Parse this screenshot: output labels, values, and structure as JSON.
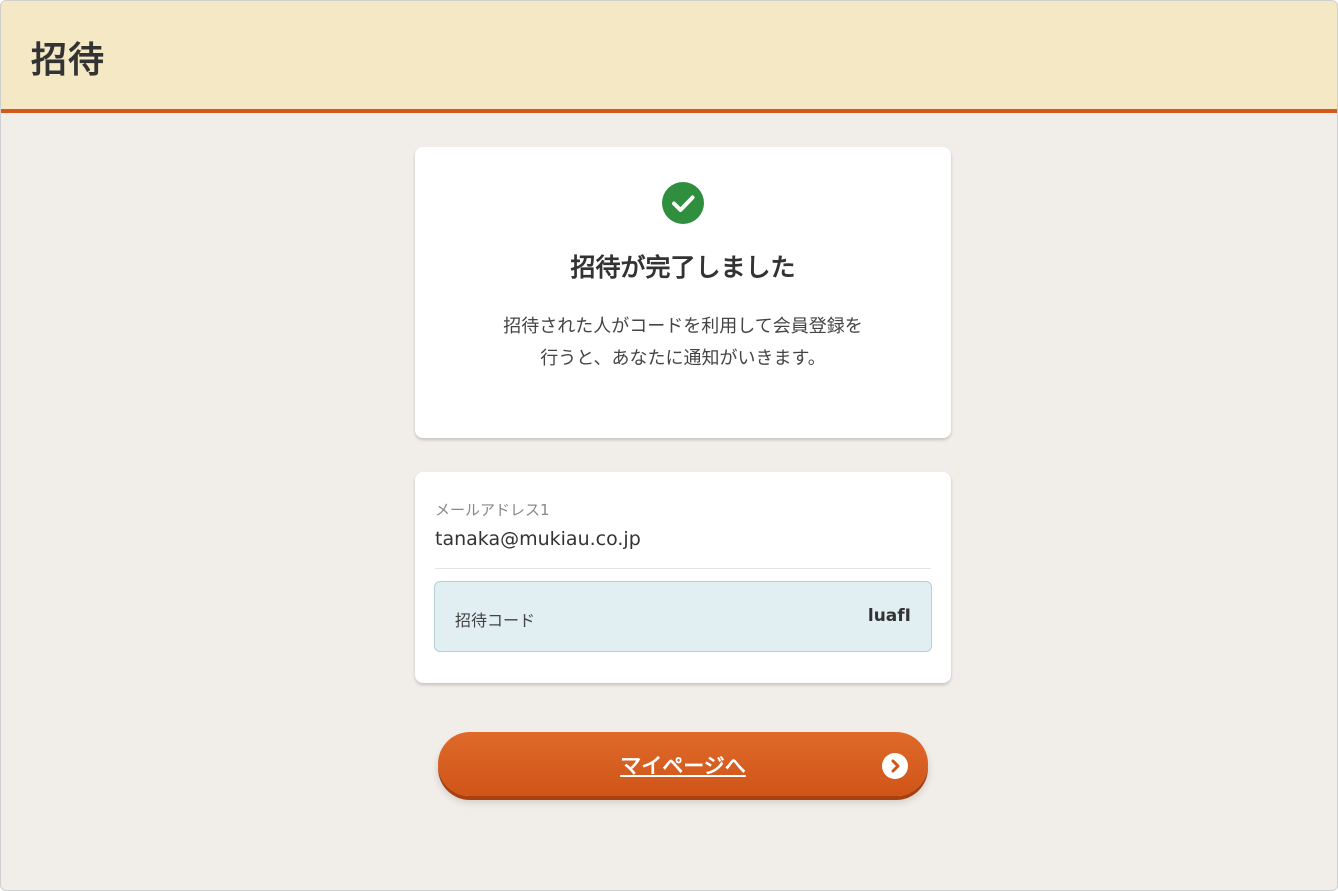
{
  "header": {
    "title": "招待"
  },
  "completion": {
    "icon": "check-circle-icon",
    "title": "招待が完了しました",
    "message": "招待された人がコードを利用して会員登録を行うと、あなたに通知がいきます。"
  },
  "invite": {
    "email_label": "メールアドレス1",
    "email_value": "tanaka@mukiau.co.jp",
    "code_label": "招待コード",
    "code_value": "luafI"
  },
  "actions": {
    "mypage_label": "マイページへ",
    "mypage_icon": "chevron-right-circle-icon"
  },
  "colors": {
    "accent": "#d35a1c",
    "success": "#2f8f3e",
    "header_bg": "#f5e8c4",
    "code_bg": "#e1eef2"
  }
}
